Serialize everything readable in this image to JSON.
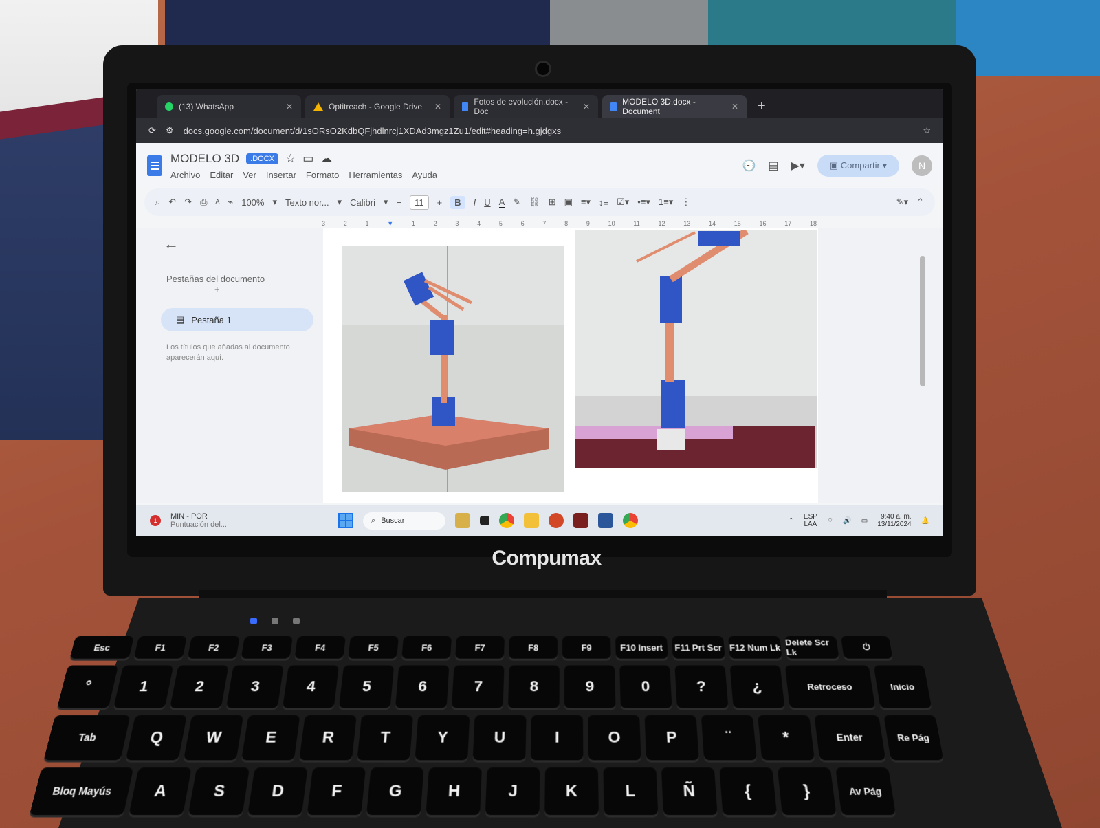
{
  "laptop_brand": "Compumax",
  "browser": {
    "tabs": [
      {
        "label": "(13) WhatsApp",
        "icon": "whatsapp-icon",
        "active": false
      },
      {
        "label": "Optitreach - Google Drive",
        "icon": "drive-icon",
        "active": false
      },
      {
        "label": "Fotos de evolución.docx - Doc",
        "icon": "docs-icon",
        "active": false
      },
      {
        "label": "MODELO 3D.docx - Document",
        "icon": "docs-icon",
        "active": true
      }
    ],
    "new_tab": "+",
    "url": "docs.google.com/document/d/1sORsO2KdbQFjhdlnrcj1XDAd3mgz1Zu1/edit#heading=h.gjdgxs"
  },
  "doc": {
    "title": "MODELO 3D",
    "badge": ".DOCX",
    "menu": [
      "Archivo",
      "Editar",
      "Ver",
      "Insertar",
      "Formato",
      "Herramientas",
      "Ayuda"
    ],
    "share_label": "Compartir",
    "avatar_letter": "N",
    "toolbar": {
      "zoom": "100%",
      "style": "Texto nor...",
      "font": "Calibri",
      "font_size": "11",
      "bold": "B",
      "italic": "I",
      "underline": "U",
      "text_color": "A"
    },
    "ruler": [
      "3",
      "2",
      "1",
      "",
      "1",
      "2",
      "3",
      "4",
      "5",
      "6",
      "7",
      "8",
      "9",
      "10",
      "11",
      "12",
      "13",
      "14",
      "15",
      "16",
      "17",
      "18"
    ]
  },
  "outline": {
    "back": "←",
    "title": "Pestañas del documento",
    "add": "+",
    "tab_label": "Pestaña 1",
    "hint": "Los títulos que añadas al documento aparecerán aquí."
  },
  "taskbar": {
    "notification_count": "1",
    "notification_title": "MIN - POR",
    "notification_sub": "Puntuación del...",
    "search_placeholder": "Buscar",
    "lang_top": "ESP",
    "lang_bottom": "LAA",
    "time": "9:40 a. m.",
    "date": "13/11/2024"
  },
  "keyboard": {
    "fn_row": [
      "Esc",
      "F1",
      "F2",
      "F3",
      "F4",
      "F5",
      "F6",
      "F7",
      "F8",
      "F9",
      "F10 Insert",
      "F11 Prt Scr",
      "F12 Num Lk",
      "Delete Scr Lk",
      "⏻"
    ],
    "num_row": [
      "°",
      "1",
      "2",
      "3",
      "4",
      "5",
      "6",
      "7",
      "8",
      "9",
      "0",
      "?",
      "¿",
      "Retroceso",
      "Inicio"
    ],
    "q_row": [
      "Tab",
      "Q",
      "W",
      "E",
      "R",
      "T",
      "Y",
      "U",
      "I",
      "O",
      "P",
      "¨",
      "*",
      "Enter",
      "Re Pág"
    ],
    "a_row": [
      "Bloq Mayús",
      "A",
      "S",
      "D",
      "F",
      "G",
      "H",
      "J",
      "K",
      "L",
      "Ñ",
      "{",
      "}",
      "Av Pág"
    ]
  },
  "colors": {
    "accent": "#3b7be8",
    "share_bg": "#c9dcf7",
    "tabbar": "#1f1f24"
  }
}
